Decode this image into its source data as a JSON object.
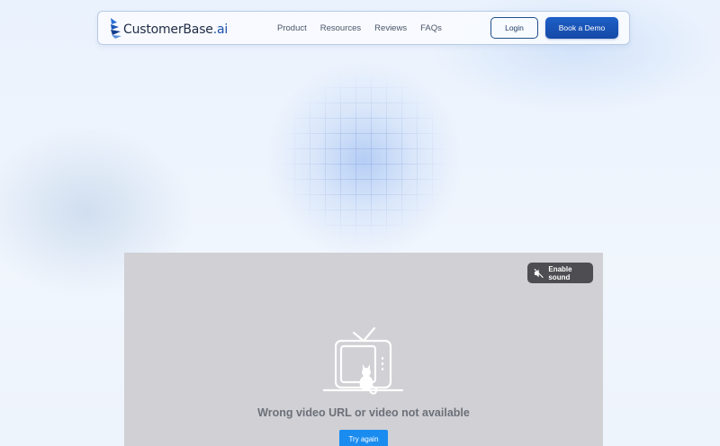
{
  "brand": {
    "name": "CustomerBase",
    "suffix": ".ai",
    "colors": {
      "primary": "#1549a6",
      "accent": "#1b4fa8",
      "text": "#1f2b44"
    }
  },
  "nav": {
    "links": [
      {
        "label": "Product"
      },
      {
        "label": "Resources"
      },
      {
        "label": "Reviews"
      },
      {
        "label": "FAQs"
      }
    ],
    "login_label": "Login",
    "demo_label": "Book a Demo"
  },
  "video": {
    "sound_label": "Enable sound",
    "sound_icon": "speaker-muted-icon",
    "illustration_icon": "tv-cat-icon",
    "error_message": "Wrong video URL or video not available",
    "retry_label": "Try again",
    "colors": {
      "background": "#d0d0d5",
      "retry_button": "#1a8cf0"
    }
  }
}
